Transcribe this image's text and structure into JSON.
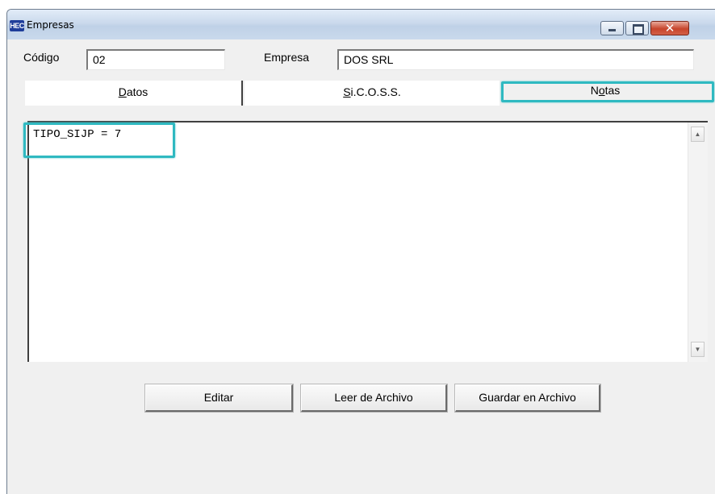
{
  "window": {
    "app_icon_text": "HEC",
    "title": "Empresas",
    "controls": {
      "minimize": "minimize",
      "maximize": "maximize",
      "close": "x"
    }
  },
  "form": {
    "codigo_label": "Código",
    "codigo_value": "02",
    "empresa_label": "Empresa",
    "empresa_value": "DOS SRL"
  },
  "tabs": [
    {
      "label_mnemonic": "D",
      "label_rest": "atos",
      "selected": false
    },
    {
      "label_mnemonic": "S",
      "label_rest": "i.C.O.S.S.",
      "selected": false
    },
    {
      "label_pre": "N",
      "label_mnemonic": "o",
      "label_rest": "tas",
      "selected": true
    }
  ],
  "notes": {
    "content": "TIPO_SIJP = 7"
  },
  "buttons": {
    "editar": "Editar",
    "leer": "Leer de Archivo",
    "guardar": "Guardar en Archivo"
  },
  "highlight_color": "#2fb9c1"
}
